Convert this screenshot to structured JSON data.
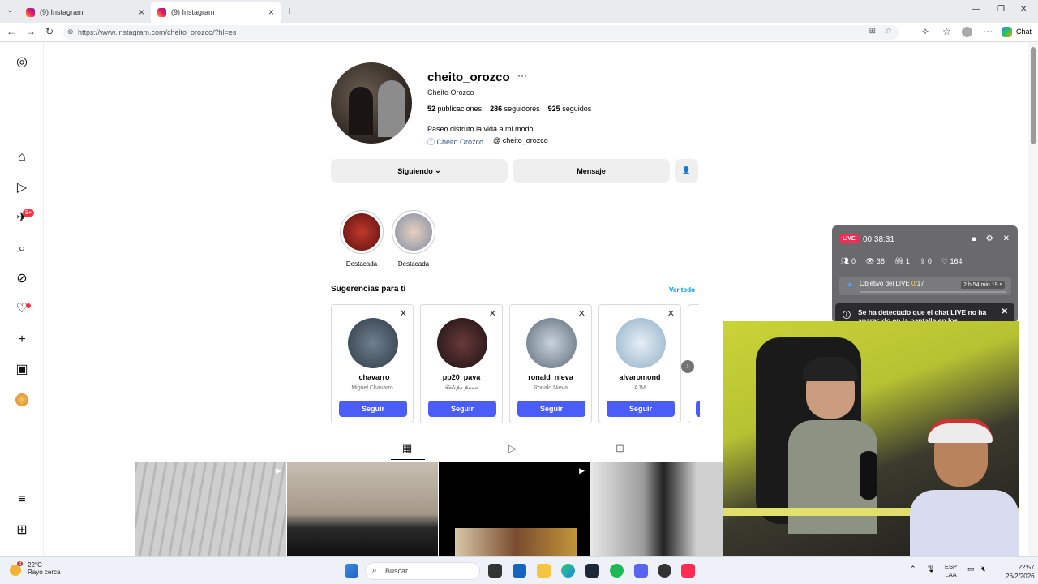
{
  "browser": {
    "tabs": [
      {
        "title": "(9) Instagram",
        "active": false
      },
      {
        "title": "(9) Instagram",
        "active": true
      }
    ],
    "url": "https://www.instagram.com/cheito_orozco/?hl=es",
    "chat_label": "Chat"
  },
  "sidebar": {
    "notification_count": "9+"
  },
  "profile": {
    "username": "cheito_orozco",
    "full_name": "Cheito Orozco",
    "posts_count": "52",
    "posts_label": "publicaciones",
    "followers_count": "286",
    "followers_label": "seguidores",
    "following_count": "925",
    "following_label": "seguidos",
    "bio": "Paseo disfruto la vida a mi modo",
    "facebook_link": "Cheito Orozco",
    "threads_link": "cheito_orozco",
    "following_button": "Siguiendo",
    "message_button": "Mensaje"
  },
  "highlights": [
    {
      "label": "Destacada",
      "color": "#8e1f1f"
    },
    {
      "label": "Destacada",
      "color": "#9aa6b8"
    }
  ],
  "suggestions": {
    "title": "Sugerencias para ti",
    "see_all": "Ver todo",
    "cards": [
      {
        "username": "_chavarro",
        "subtitle": "Miguel Chavarro",
        "button": "Seguir",
        "color": "#4c5a6a"
      },
      {
        "username": "pp20_pava",
        "subtitle": "𝓕𝓮𝓵𝓲𝓹𝓮 𝓹𝓪𝓿𝓪",
        "button": "Seguir",
        "color": "#2a1c22"
      },
      {
        "username": "ronald_nieva",
        "subtitle": "Ronald Nieva",
        "button": "Seguir",
        "color": "#8a9aa8"
      },
      {
        "username": "alvaromond",
        "subtitle": "AJM",
        "button": "Seguir",
        "color": "#a9c3d6"
      }
    ]
  },
  "live": {
    "badge": "LIVE",
    "timer": "00:38:31",
    "viewers_count": "0",
    "views": "38",
    "gifts": "1",
    "shares": "0",
    "likes": "164",
    "goal_label": "Objetivo del LIVE",
    "goal_current": "0",
    "goal_total": "/17",
    "goal_time_left": "2 h 54 min 19 s",
    "alert": "Se ha detectado que el chat LIVE no ha aparecido en la pantalla en los"
  },
  "taskbar": {
    "weather_badge": "3",
    "temperature": "22°C",
    "weather_desc": "Rayo cerca",
    "search_placeholder": "Buscar",
    "lang_top": "ESP",
    "lang_bottom": "LAA",
    "time": "22:57",
    "date": "26/2/2026"
  }
}
